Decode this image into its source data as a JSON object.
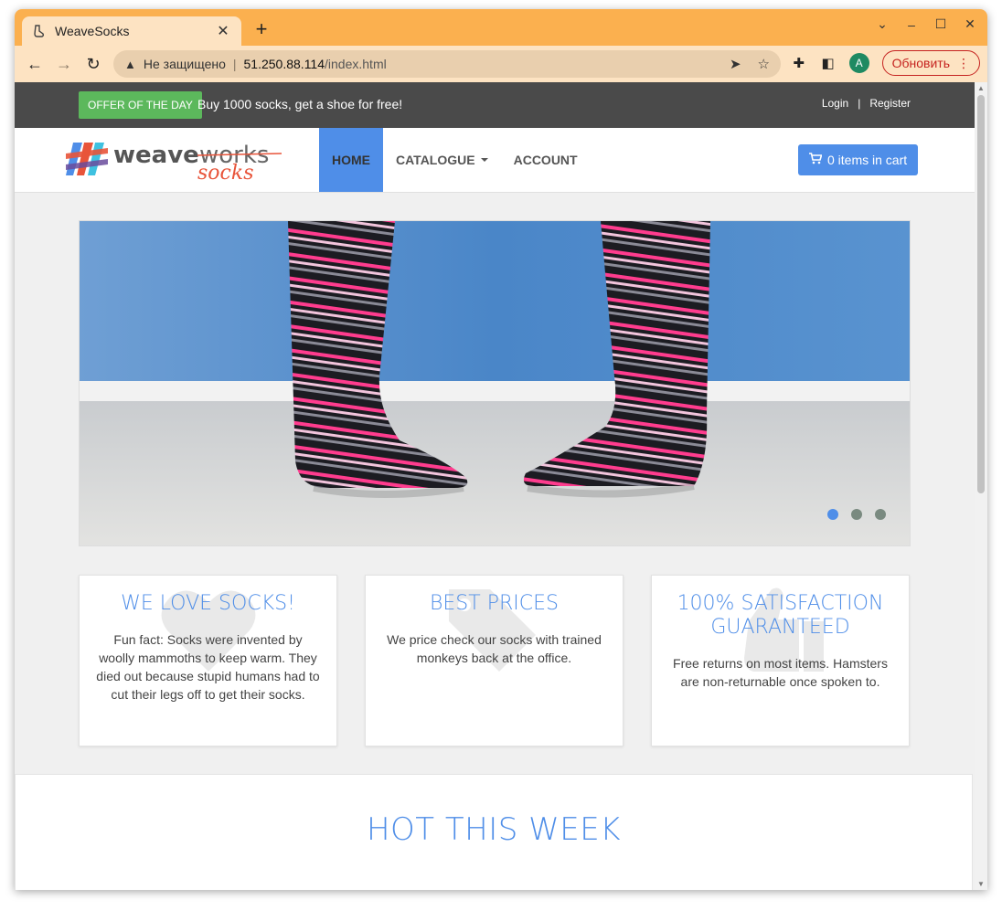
{
  "browser": {
    "tab_title": "WeaveSocks",
    "new_tab": "+",
    "url_security": "Не защищено",
    "url_host": "51.250.88.114",
    "url_path": "/index.html",
    "avatar_letter": "A",
    "update_label": "Обновить"
  },
  "topbar": {
    "offer_badge": "OFFER OF THE DAY",
    "offer_text": "Buy 1000 socks, get a shoe for free!",
    "login": "Login",
    "separator": "|",
    "register": "Register"
  },
  "logo": {
    "word1": "weave",
    "word2": "works",
    "word3": "socks"
  },
  "nav": {
    "home": "HOME",
    "catalogue": "CATALOGUE",
    "account": "ACCOUNT",
    "cart": "0 items in cart"
  },
  "carousel": {
    "slide_count": 3,
    "active_slide": 1
  },
  "features": [
    {
      "title": "WE LOVE SOCKS!",
      "text": "Fun fact: Socks were invented by woolly mammoths to keep warm. They died out because stupid humans had to cut their legs off to get their socks."
    },
    {
      "title": "BEST PRICES",
      "text": "We price check our socks with trained monkeys back at the office."
    },
    {
      "title": "100% SATISFACTION GUARANTEED",
      "text": "Free returns on most items. Hamsters are non-returnable once spoken to."
    }
  ],
  "hot": {
    "title": "HOT THIS WEEK"
  },
  "colors": {
    "accent": "#4f8ee8",
    "offer_green": "#5cb85c",
    "topbar": "#4a4a4a",
    "chrome_frame": "#fbb04f"
  }
}
